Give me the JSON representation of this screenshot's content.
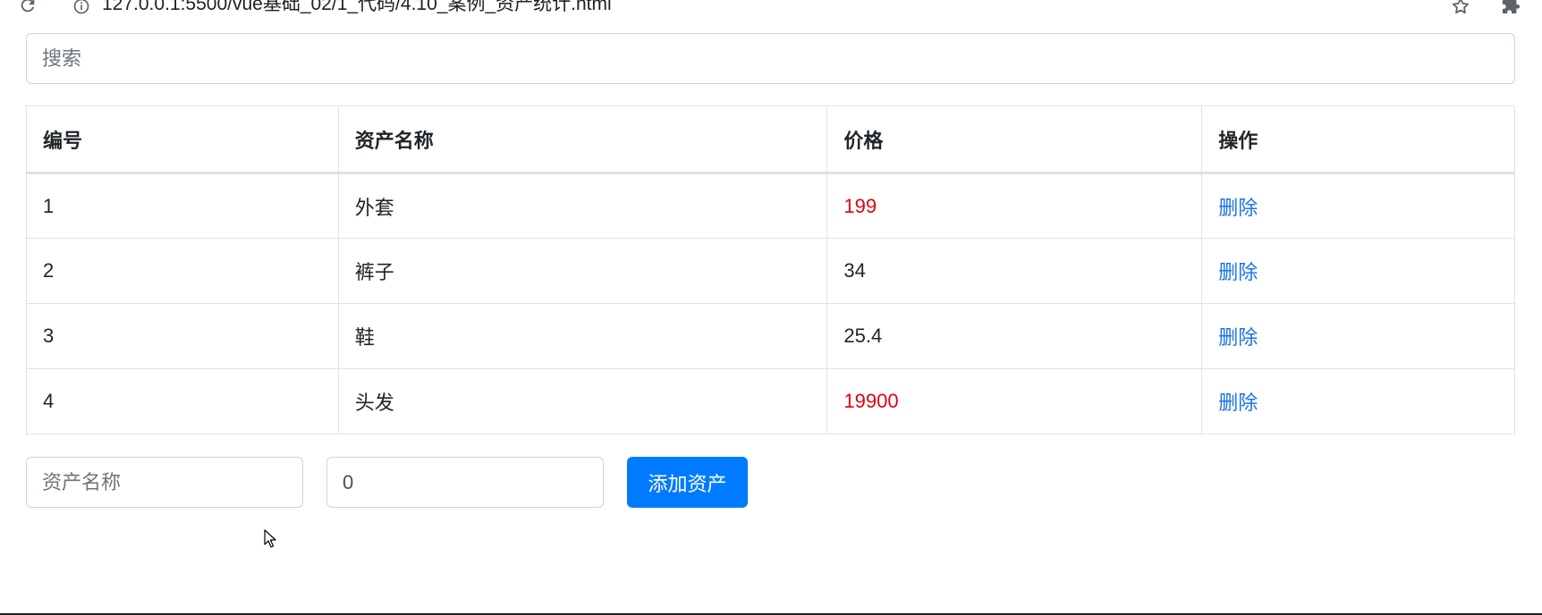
{
  "browser": {
    "url": "127.0.0.1:5500/vue基础_02/1_代码/4.10_案例_资产统计.html",
    "icons": [
      "reload-icon",
      "info-icon",
      "star-icon",
      "extensions-icon"
    ]
  },
  "search": {
    "placeholder": "搜索"
  },
  "table": {
    "headers": [
      "编号",
      "资产名称",
      "价格",
      "操作"
    ],
    "rows": [
      {
        "id": "1",
        "name": "外套",
        "price": "199",
        "action": "删除",
        "price_highlight": true
      },
      {
        "id": "2",
        "name": "裤子",
        "price": "34",
        "action": "删除",
        "price_highlight": false
      },
      {
        "id": "3",
        "name": "鞋",
        "price": "25.4",
        "action": "删除",
        "price_highlight": false
      },
      {
        "id": "4",
        "name": "头发",
        "price": "19900",
        "action": "删除",
        "price_highlight": true
      }
    ]
  },
  "form": {
    "name_placeholder": "资产名称",
    "price_value": "0",
    "add_label": "添加资产"
  },
  "colors": {
    "primary": "#007bff",
    "price_highlight": "#e3000f",
    "link": "#1a73e8",
    "border": "#dee2e6"
  }
}
